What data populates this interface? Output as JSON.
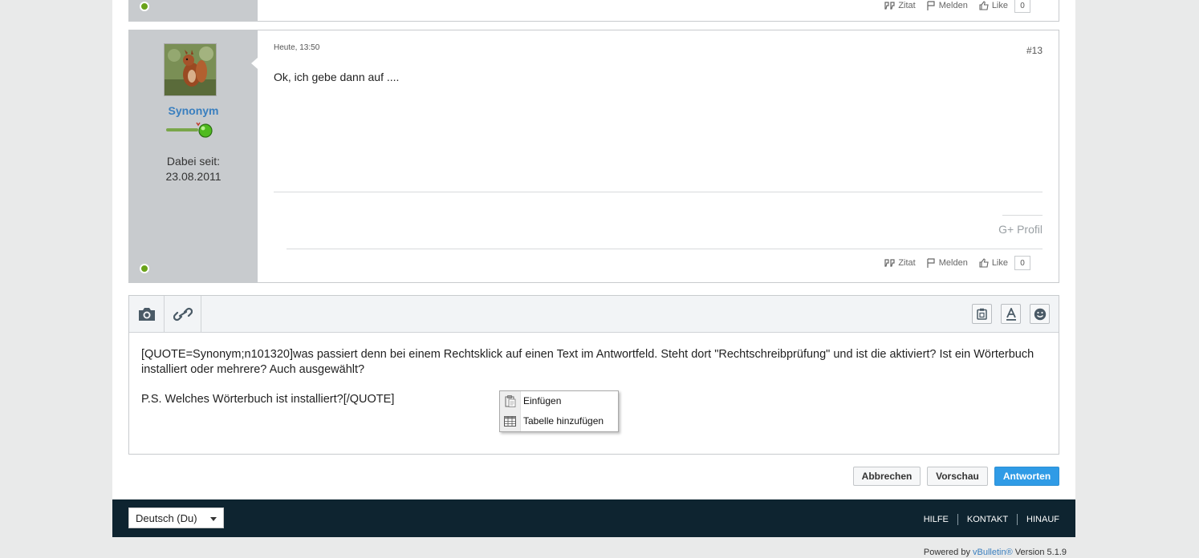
{
  "prev_post": {
    "actions": {
      "quote": "Zitat",
      "report": "Melden",
      "like": "Like",
      "like_count": "0"
    }
  },
  "post": {
    "date": "Heute, 13:50",
    "number": "#13",
    "text": "Ok, ich gebe dann auf ....",
    "username": "Synonym",
    "joined_label": "Dabei seit:",
    "joined_date": "23.08.2011",
    "gplus": "G+ Profil",
    "actions": {
      "quote": "Zitat",
      "report": "Melden",
      "like": "Like",
      "like_count": "0"
    }
  },
  "editor": {
    "paragraph1": "[QUOTE=Synonym;n101320]was passiert denn bei einem Rechtsklick auf einen Text im Antwortfeld. Steht dort \"Rechtschreibprüfung\" und ist die aktiviert? Ist ein Wörterbuch installiert oder mehrere? Auch ausgewählt?",
    "paragraph2": "P.S. Welches Wörterbuch ist installiert?[/QUOTE]",
    "toolbar_icons": [
      "camera-icon",
      "link-icon",
      "clipboard-icon",
      "text-format-icon",
      "smiley-icon"
    ]
  },
  "context_menu": {
    "items": [
      {
        "label": "Einfügen",
        "icon": "paste-icon"
      },
      {
        "label": "Tabelle hinzufügen",
        "icon": "table-icon"
      }
    ]
  },
  "buttons": {
    "cancel": "Abbrechen",
    "preview": "Vorschau",
    "reply": "Antworten"
  },
  "footer": {
    "language": "Deutsch (Du)",
    "links": [
      "HILFE",
      "KONTAKT",
      "HINAUF"
    ],
    "powered_prefix": "Powered by",
    "powered_brand": "vBulletin®",
    "powered_version": "Version 5.1.9"
  },
  "colors": {
    "accent": "#2f9be6",
    "username": "#3a7fbf",
    "sidebar": "#c8cbce",
    "footer": "#0e2430",
    "online": "#6aa31a"
  }
}
